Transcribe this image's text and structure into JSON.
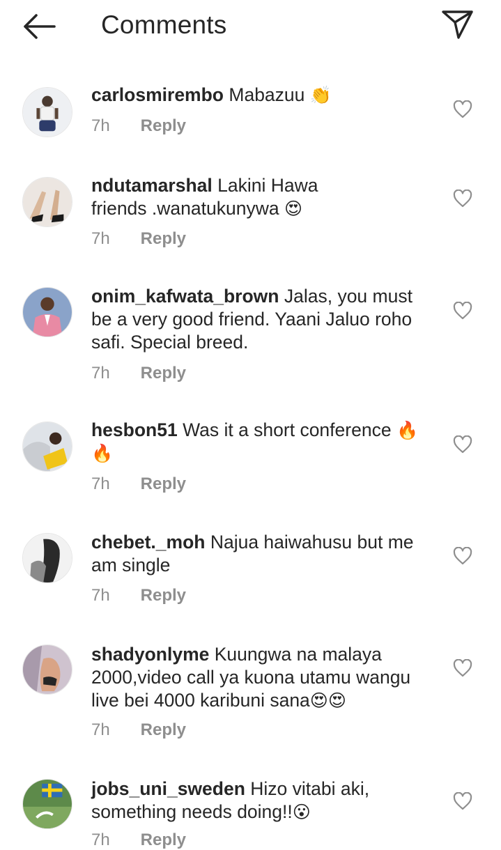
{
  "header": {
    "title": "Comments",
    "back_icon": "arrow-left-icon",
    "send_icon": "paper-plane-icon"
  },
  "comments": [
    {
      "username": "carlosmirembo",
      "text": "Mabazuu",
      "emoji": "👏",
      "time": "7h",
      "reply": "Reply"
    },
    {
      "username": "ndutamarshal",
      "text": "Lakini Hawa friends .wanatukunywa",
      "emoji": "😍",
      "time": "7h",
      "reply": "Reply"
    },
    {
      "username": "onim_kafwata_brown",
      "text": "Jalas, you must be a very good friend. Yaani Jaluo roho safi. Special breed.",
      "emoji": "",
      "time": "7h",
      "reply": "Reply"
    },
    {
      "username": "hesbon51",
      "text": "Was it a short conference",
      "emoji": "🔥 🔥",
      "time": "7h",
      "reply": "Reply"
    },
    {
      "username": "chebet._moh",
      "text": "Najua haiwahusu but me am single",
      "emoji": "",
      "time": "7h",
      "reply": "Reply"
    },
    {
      "username": "shadyonlyme",
      "text": "Kuungwa na malaya 2000,video call ya kuona utamu wangu live bei 4000 karibuni sana",
      "emoji": "😍😍",
      "time": "7h",
      "reply": "Reply"
    },
    {
      "username": "jobs_uni_sweden",
      "text": "Hizo vitabi aki, something needs doing!!",
      "emoji": "😮",
      "time": "7h",
      "reply": "Reply"
    }
  ],
  "colors": {
    "text": "#262626",
    "secondary": "#8e8e8e",
    "background": "#ffffff"
  },
  "icons": {
    "like": "heart-outline-icon"
  }
}
